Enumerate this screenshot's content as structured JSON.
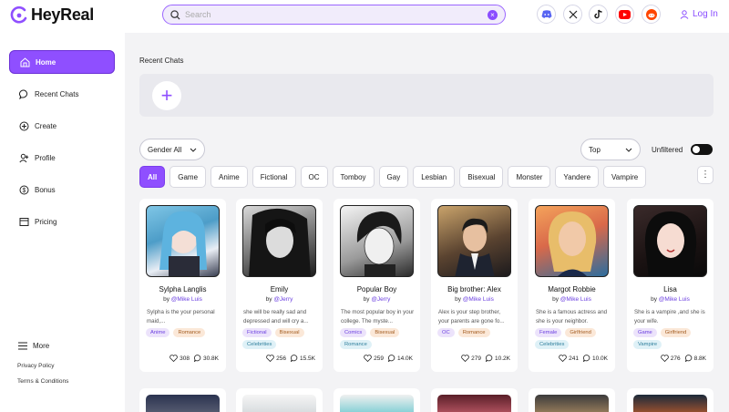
{
  "app": {
    "name": "HeyReal"
  },
  "search": {
    "placeholder": "Search"
  },
  "header": {
    "login_label": "Log In",
    "socials": [
      "discord-icon",
      "x-icon",
      "tiktok-icon",
      "youtube-icon",
      "reddit-icon"
    ]
  },
  "sidebar": {
    "items": [
      {
        "label": "Home",
        "icon": "home-icon"
      },
      {
        "label": "Recent Chats",
        "icon": "chat-icon"
      },
      {
        "label": "Create",
        "icon": "plus-circle-icon"
      },
      {
        "label": "Profile",
        "icon": "user-plus-icon"
      },
      {
        "label": "Bonus",
        "icon": "dollar-icon"
      },
      {
        "label": "Pricing",
        "icon": "card-icon"
      }
    ],
    "more_label": "More",
    "privacy_label": "Privacy Policy",
    "terms_label": "Terms & Conditions"
  },
  "main": {
    "recent_title": "Recent Chats",
    "gender_filter": "Gender All",
    "sort_filter": "Top",
    "unfiltered_label": "Unfiltered",
    "tags": [
      "All",
      "Game",
      "Anime",
      "Fictional",
      "OC",
      "Tomboy",
      "Gay",
      "Lesbian",
      "Bisexual",
      "Monster",
      "Yandere",
      "Vampire"
    ]
  },
  "cards": [
    {
      "name": "Sylpha Langlis",
      "by": "by ",
      "author": "@Mike Luis",
      "desc": "Sylpha is the your personal maid,...",
      "tags": [
        {
          "t": "Anime",
          "c": "p"
        },
        {
          "t": "Romance",
          "c": "o"
        }
      ],
      "likes": "308",
      "chats": "30.8K"
    },
    {
      "name": "Emily",
      "by": "by ",
      "author": "@Jerry",
      "desc": "she will be really sad and depressed and will cry a...",
      "tags": [
        {
          "t": "Fictional",
          "c": "p"
        },
        {
          "t": "Bisexual",
          "c": "o"
        },
        {
          "t": "Celebrities",
          "c": "b"
        }
      ],
      "likes": "256",
      "chats": "15.5K"
    },
    {
      "name": "Popular Boy",
      "by": "by ",
      "author": "@Jerry",
      "desc": "The most popular boy in your college. The myste...",
      "tags": [
        {
          "t": "Comics",
          "c": "p"
        },
        {
          "t": "Bisexual",
          "c": "o"
        },
        {
          "t": "Romance",
          "c": "b"
        }
      ],
      "likes": "259",
      "chats": "14.0K"
    },
    {
      "name": "Big brother: Alex",
      "by": "by ",
      "author": "@Mike Luis",
      "desc": "Alex is your step brother, your parents are gone fo...",
      "tags": [
        {
          "t": "OC",
          "c": "p"
        },
        {
          "t": "Romance",
          "c": "o"
        }
      ],
      "likes": "279",
      "chats": "10.2K"
    },
    {
      "name": "Margot Robbie",
      "by": "by ",
      "author": "@Mike Luis",
      "desc": "She is a famous actress and she is your neighbor.",
      "tags": [
        {
          "t": "Female",
          "c": "p"
        },
        {
          "t": "Girlfriend",
          "c": "o"
        },
        {
          "t": "Celebrities",
          "c": "b"
        }
      ],
      "likes": "241",
      "chats": "10.0K"
    },
    {
      "name": "Lisa",
      "by": "by ",
      "author": "@Mike Luis",
      "desc": "She is a vampire ,and she is your wife.",
      "tags": [
        {
          "t": "Game",
          "c": "p"
        },
        {
          "t": "Girlfriend",
          "c": "o"
        },
        {
          "t": "Vampire",
          "c": "b"
        }
      ],
      "likes": "276",
      "chats": "8.8K"
    }
  ],
  "colors": {
    "accent": "#8f4fff",
    "accent_dark": "#6b3fe0",
    "bg": "#f3f3f5"
  }
}
